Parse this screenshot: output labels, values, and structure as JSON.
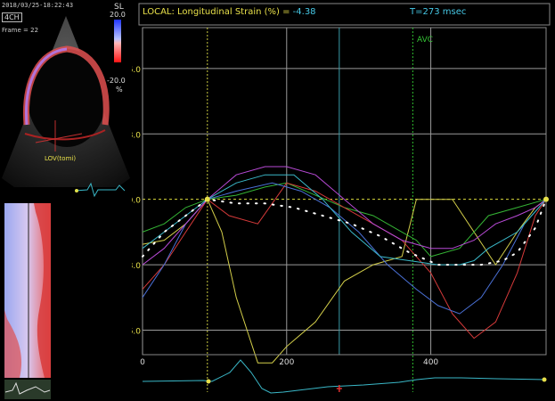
{
  "echo": {
    "timestamp": "2018/03/25-18:22:43",
    "view_tag": "4CH",
    "frame_label": "Frame = 22",
    "param": "SL",
    "scale_max": "20.0",
    "scale_min": "-20.0",
    "scale_unit": "%",
    "lv_label": "LOV(tomi)"
  },
  "header": {
    "local_prefix": "LOCAL",
    "title": ": Longitudinal Strain (%) = ",
    "value": "-4.38",
    "time": "T=273 msec"
  },
  "event_label": "AVC",
  "colors": {
    "background": "#000000",
    "grid": "#9a9a9a",
    "zero_line": "#dcdc3c",
    "event_line": "#2fbf2f",
    "time_cursor": "#3a9aa6",
    "header_yellow": "#e8e04a",
    "header_cyan": "#46c8e6"
  },
  "chart_data": {
    "type": "line",
    "ylabel": "",
    "xlabel": "",
    "xlim": [
      0,
      560
    ],
    "ylim": [
      -19,
      21
    ],
    "y_ticks": [
      16.0,
      8.0,
      0.0,
      -8.0,
      -16.0
    ],
    "y_tick_labels": [
      "16.0",
      "8.0",
      "0.0",
      "-8.0",
      "-16.0"
    ],
    "x_ticks": [
      0,
      200,
      400
    ],
    "x_tick_labels": [
      "0",
      "200",
      "400"
    ],
    "event_markers": [
      {
        "label": "AVC",
        "x": 375
      }
    ],
    "time_cursor_x": 273,
    "reference_x": [
      90
    ],
    "grid": true,
    "series": [
      {
        "color": "#d4cf4a",
        "x": [
          0,
          30,
          60,
          90,
          110,
          130,
          160,
          180,
          200,
          240,
          280,
          320,
          360,
          380,
          400,
          430,
          460,
          490,
          520,
          545,
          560
        ],
        "y": [
          -5.5,
          -5,
          -3,
          0,
          -4,
          -12,
          -20,
          -20,
          -18,
          -15,
          -10,
          -8,
          -7,
          0,
          0,
          0,
          -4,
          -8,
          -4,
          -1,
          0
        ]
      },
      {
        "color": "#35b535",
        "x": [
          0,
          30,
          60,
          90,
          130,
          170,
          200,
          240,
          280,
          320,
          360,
          380,
          400,
          440,
          480,
          520,
          560
        ],
        "y": [
          -4,
          -3,
          -1,
          0,
          0.5,
          1.5,
          2,
          0.5,
          -1,
          -2,
          -4,
          -5,
          -7,
          -6,
          -2,
          -1,
          0
        ]
      },
      {
        "color": "#d63a3a",
        "x": [
          0,
          30,
          60,
          90,
          120,
          160,
          200,
          240,
          280,
          320,
          360,
          400,
          430,
          460,
          490,
          520,
          545,
          560
        ],
        "y": [
          -11,
          -8,
          -4,
          0,
          -2,
          -3,
          2,
          1,
          -1,
          -3,
          -5,
          -9,
          -14,
          -17,
          -15,
          -9,
          -2,
          0
        ]
      },
      {
        "color": "#4a70d6",
        "x": [
          0,
          30,
          60,
          90,
          130,
          180,
          220,
          260,
          300,
          340,
          380,
          410,
          440,
          470,
          500,
          530,
          560
        ],
        "y": [
          -12,
          -8,
          -3,
          0,
          1,
          2,
          1,
          -1,
          -4,
          -8,
          -11,
          -13,
          -14,
          -12,
          -8,
          -3,
          0
        ]
      },
      {
        "color": "#b84ad6",
        "x": [
          0,
          30,
          60,
          90,
          130,
          170,
          200,
          240,
          280,
          320,
          360,
          400,
          430,
          460,
          490,
          520,
          545,
          560
        ],
        "y": [
          -8,
          -6,
          -3,
          0,
          3,
          4,
          4,
          3,
          0,
          -3,
          -5,
          -6,
          -6,
          -5,
          -3,
          -2,
          -1,
          0
        ]
      },
      {
        "color": "#3ab8c8",
        "x": [
          0,
          30,
          60,
          90,
          130,
          170,
          210,
          250,
          290,
          330,
          370,
          410,
          440,
          460,
          480,
          500,
          520,
          540,
          560
        ],
        "y": [
          -6,
          -4,
          -2,
          0,
          2,
          3,
          3,
          0,
          -4,
          -7,
          -7.5,
          -8,
          -8,
          -7.5,
          -6,
          -5,
          -4,
          -2,
          0
        ]
      },
      {
        "color": "#ffffff",
        "dashed": true,
        "x": [
          0,
          30,
          60,
          90,
          130,
          170,
          210,
          250,
          290,
          330,
          370,
          410,
          440,
          470,
          500,
          520,
          545,
          560
        ],
        "y": [
          -7,
          -4,
          -2,
          0,
          -0.5,
          -0.5,
          -1,
          -2,
          -3,
          -4.5,
          -6.5,
          -8,
          -8,
          -8,
          -7.5,
          -6.5,
          -3.5,
          0
        ]
      }
    ]
  }
}
